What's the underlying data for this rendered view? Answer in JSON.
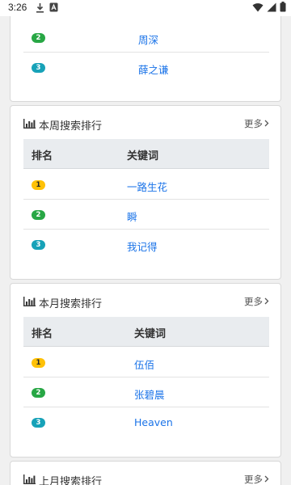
{
  "status_bar": {
    "time": "3:26"
  },
  "top_card": {
    "rows": [
      {
        "rank": "2",
        "keyword": "周深"
      },
      {
        "rank": "3",
        "keyword": "薛之谦"
      }
    ]
  },
  "week_card": {
    "title": "本周搜索排行",
    "more": "更多",
    "col_rank": "排名",
    "col_keyword": "关键词",
    "rows": [
      {
        "rank": "1",
        "keyword": "一路生花"
      },
      {
        "rank": "2",
        "keyword": "瞬"
      },
      {
        "rank": "3",
        "keyword": "我记得"
      }
    ]
  },
  "month_card": {
    "title": "本月搜索排行",
    "more": "更多",
    "col_rank": "排名",
    "col_keyword": "关键词",
    "rows": [
      {
        "rank": "1",
        "keyword": "伍佰"
      },
      {
        "rank": "2",
        "keyword": "张碧晨"
      },
      {
        "rank": "3",
        "keyword": "Heaven"
      }
    ]
  },
  "last_month_card": {
    "title": "上月搜索排行",
    "more": "更多"
  },
  "colors": {
    "badge_gold": "#ffc107",
    "badge_green": "#28a745",
    "badge_teal": "#17a2b8",
    "link_blue": "#1a73e8"
  }
}
